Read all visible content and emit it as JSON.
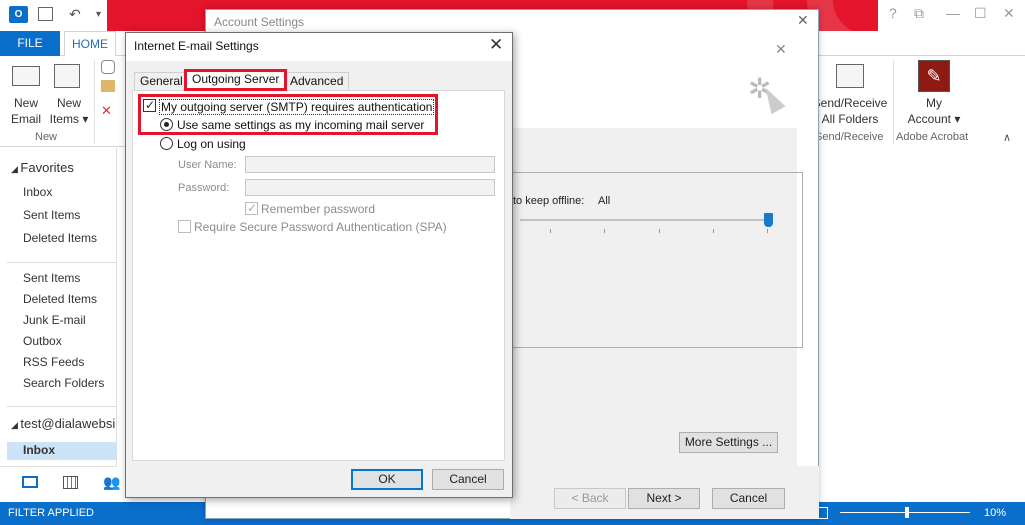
{
  "app": {
    "quick_access": {
      "undo": "↶",
      "dropdown": "▾"
    },
    "window_controls": {
      "help": "?",
      "restore_ribbon": "⧉",
      "minimize": "—",
      "maximize": "☐",
      "close": "✕"
    }
  },
  "ribbon": {
    "file_tab": "FILE",
    "home_tab": "HOME",
    "new_email": "New\nEmail",
    "new_items": "New\nItems ▾",
    "group_new": "New",
    "send_receive": "Send/Receive\nAll Folders",
    "group_send_receive": "Send/Receive",
    "my_account": "My\nAccount ▾",
    "group_adobe": "Adobe Acrobat",
    "collapse": "∧"
  },
  "nav": {
    "favorites": "Favorites",
    "fav_items": [
      "Inbox",
      "Sent Items",
      "Deleted Items"
    ],
    "folders": [
      "Sent Items",
      "Deleted Items",
      "Junk E-mail",
      "Outbox",
      "RSS Feeds",
      "Search Folders"
    ],
    "account": "test@dialawebsi",
    "selected": "Inbox"
  },
  "status": {
    "filter": "FILTER APPLIED",
    "zoom": "10%"
  },
  "account_settings": {
    "title": "Account Settings",
    "offline_label": "to keep offline:",
    "offline_value": "All",
    "more_settings": "More Settings ...",
    "back": "< Back",
    "next": "Next >",
    "cancel": "Cancel"
  },
  "dialog": {
    "title": "Internet E-mail Settings",
    "tabs": [
      "General",
      "Outgoing Server",
      "Advanced"
    ],
    "smtp_auth": "My outgoing server (SMTP) requires authentication",
    "same_settings": "Use same settings as my incoming mail server",
    "logon_using": "Log on using",
    "user_name_label": "User Name:",
    "password_label": "Password:",
    "remember_password": "Remember password",
    "require_spa": "Require Secure Password Authentication (SPA)",
    "ok": "OK",
    "cancel": "Cancel"
  },
  "colors": {
    "accent_blue": "#0a6ecb",
    "brand_red": "#e3142b"
  }
}
